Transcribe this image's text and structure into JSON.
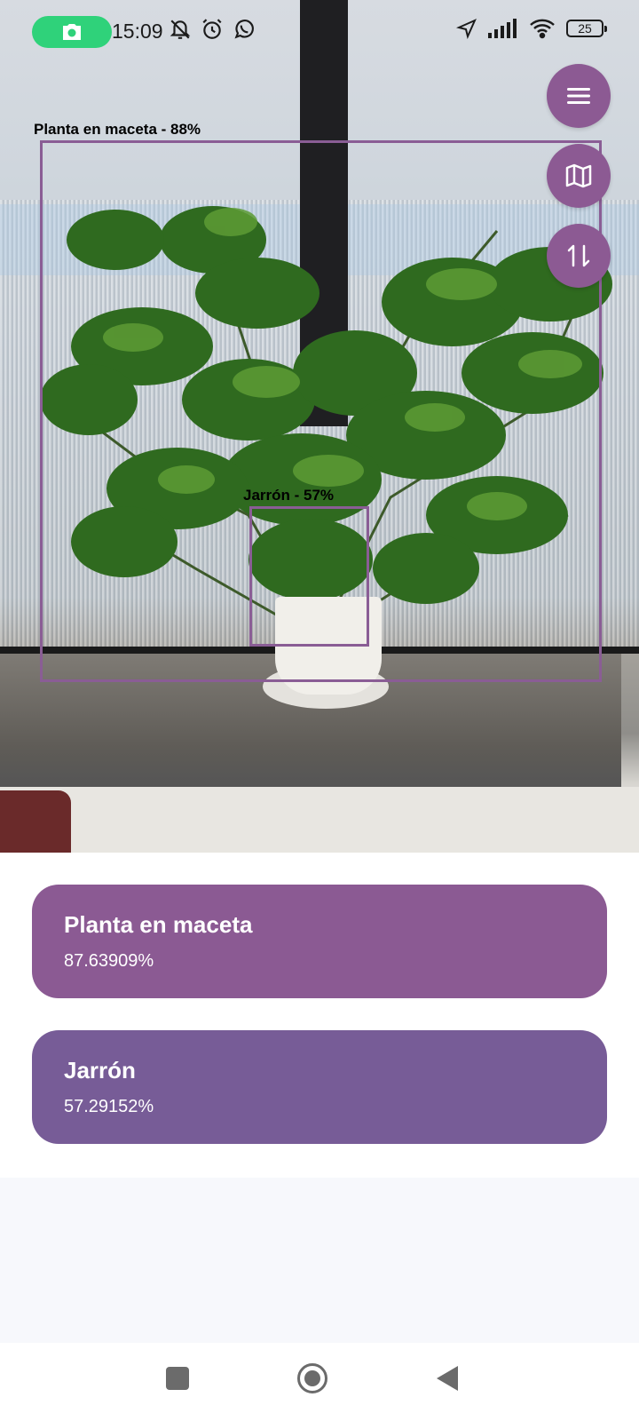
{
  "status_bar": {
    "time": "15:09",
    "battery": "25"
  },
  "detections": [
    {
      "label": "Planta en maceta - 88%"
    },
    {
      "label": "Jarrón - 57%"
    }
  ],
  "fab_buttons": [
    {
      "icon": "menu-icon"
    },
    {
      "icon": "map-icon"
    },
    {
      "icon": "swap-vertical-icon"
    }
  ],
  "results": [
    {
      "title": "Planta en maceta",
      "value": "87.63909%"
    },
    {
      "title": "Jarrón",
      "value": "57.29152%"
    }
  ],
  "colors": {
    "primary": "#8b5a93",
    "secondary": "#775c97",
    "camera_pill": "#2fd27a"
  },
  "nav_bar": {
    "buttons": [
      "recents-icon",
      "home-icon",
      "back-icon"
    ]
  }
}
